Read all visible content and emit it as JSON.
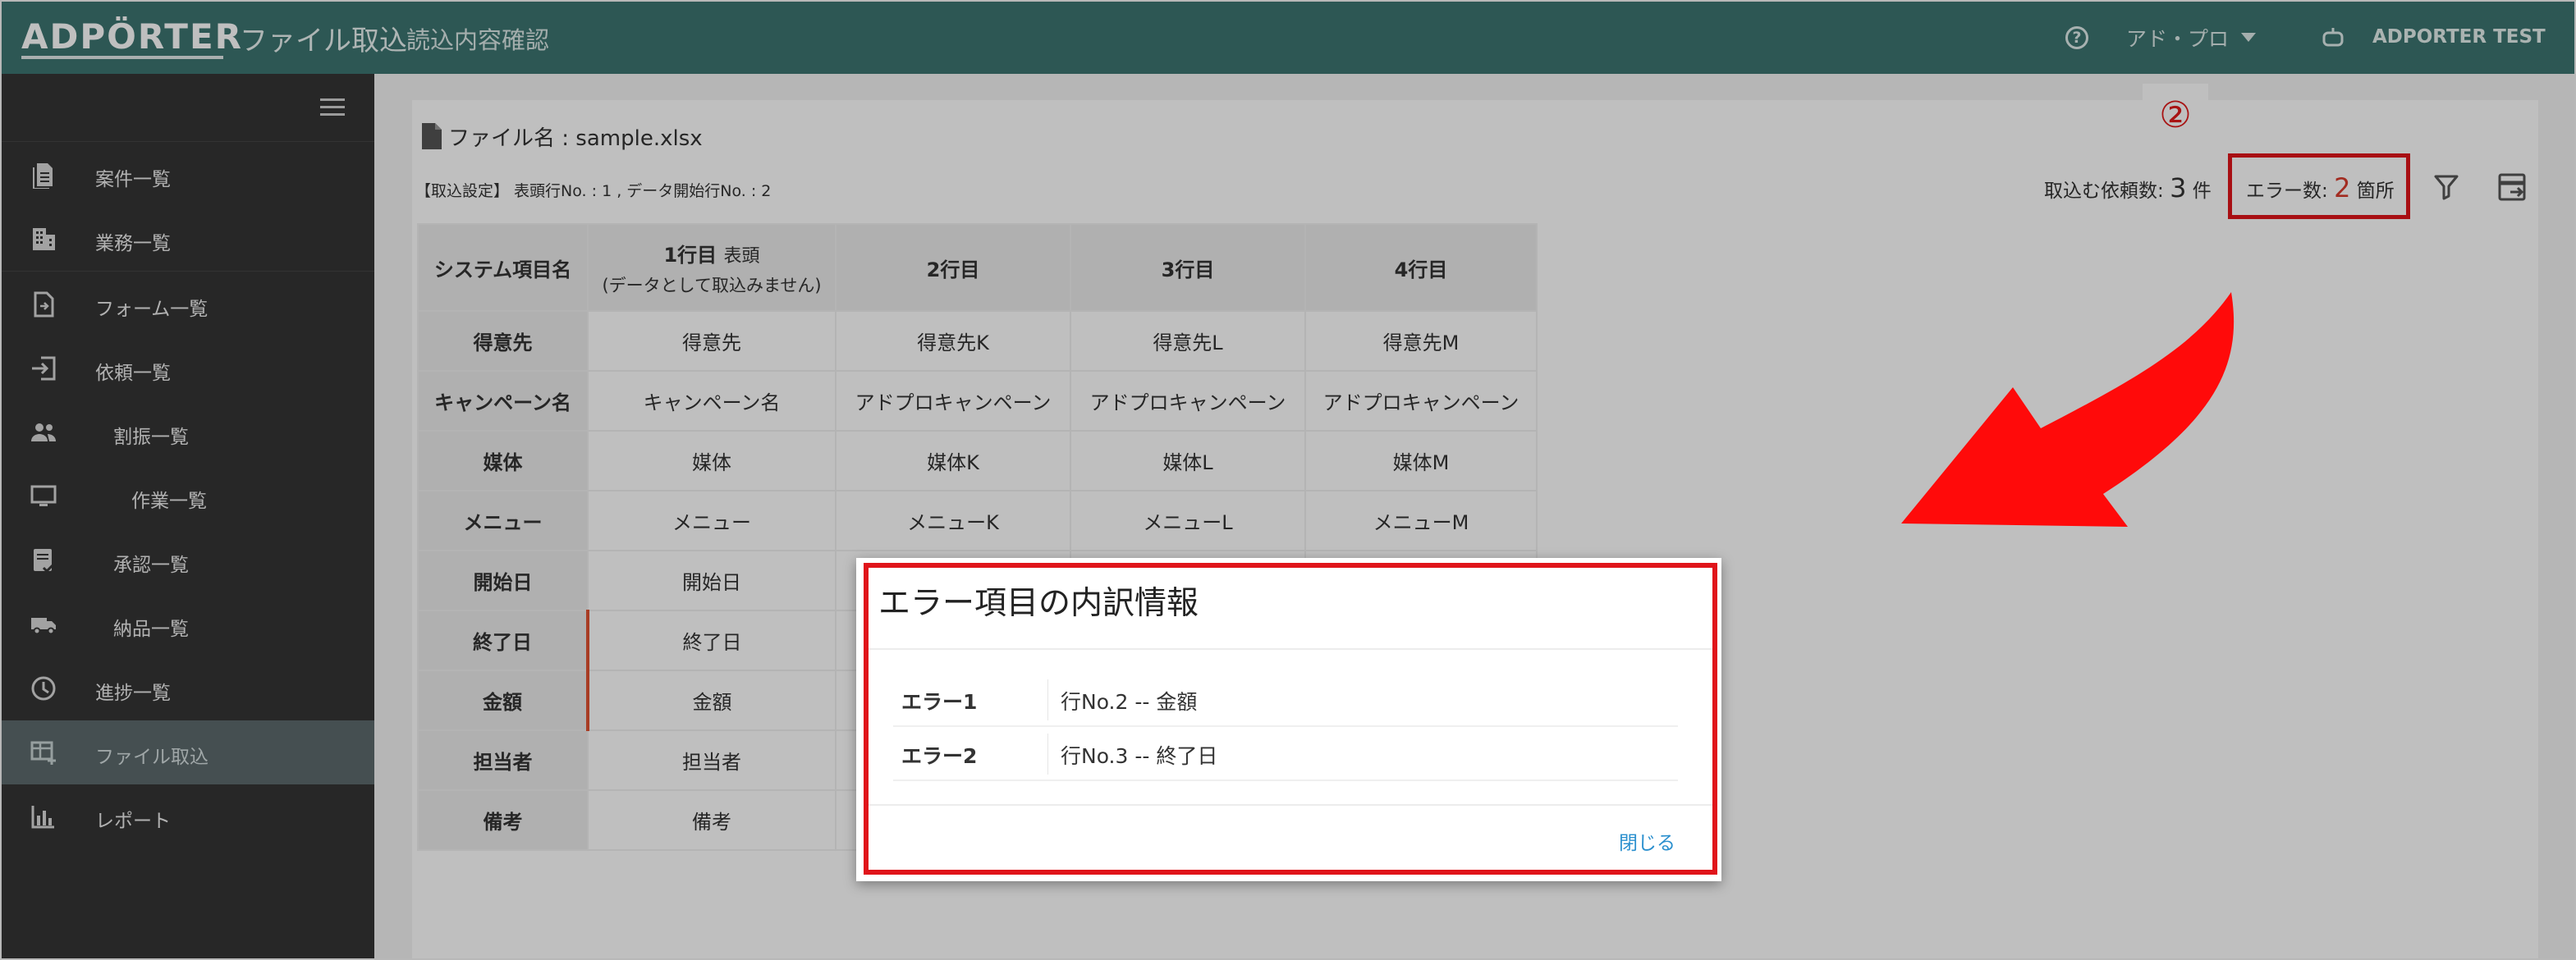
{
  "header": {
    "logo": "ADPÖRTER",
    "app_title": "ファイル取込",
    "app_subtitle": "読込内容確認",
    "help_icon": "question-circle-icon",
    "user_menu_label": "アド・プロ",
    "account_name": "ADPORTER TEST",
    "colors": {
      "bar": "#3d7570"
    }
  },
  "sidebar": {
    "items": [
      {
        "label": "案件一覧",
        "icon": "document-list-icon"
      },
      {
        "label": "業務一覧",
        "icon": "building-icon"
      },
      {
        "label": "フォーム一覧",
        "icon": "form-file-icon"
      },
      {
        "label": "依頼一覧",
        "icon": "sign-in-icon"
      },
      {
        "label": "割振一覧",
        "icon": "people-icon"
      },
      {
        "label": "作業一覧",
        "icon": "monitor-icon"
      },
      {
        "label": "承認一覧",
        "icon": "approval-icon"
      },
      {
        "label": "納品一覧",
        "icon": "truck-icon"
      },
      {
        "label": "進捗一覧",
        "icon": "clock-icon"
      },
      {
        "label": "ファイル取込",
        "icon": "table-add-icon",
        "active": true
      },
      {
        "label": "レポート",
        "icon": "bar-chart-icon"
      }
    ]
  },
  "main": {
    "file_label": "ファイル名 : sample.xlsx",
    "import_setting": "【取込設定】 表頭行No. : 1 , データ開始行No. : 2",
    "count_prefix": "取込む依頼数:",
    "count_value": "3",
    "count_suffix": "件",
    "error_prefix": "エラー数:",
    "error_value": "2",
    "error_suffix": "箇所",
    "step_badge": "②",
    "table": {
      "headers": [
        "システム項目名",
        "1行目",
        "2行目",
        "3行目",
        "4行目"
      ],
      "header1_tag": "表頭",
      "header1_note": "(データとして取込みません)",
      "rows": [
        [
          "得意先",
          "得意先",
          "得意先K",
          "得意先L",
          "得意先M"
        ],
        [
          "キャンペーン名",
          "キャンペーン名",
          "アドプロキャンペーン",
          "アドプロキャンペーン",
          "アドプロキャンペーン"
        ],
        [
          "媒体",
          "媒体",
          "媒体K",
          "媒体L",
          "媒体M"
        ],
        [
          "メニュー",
          "メニュー",
          "メニューK",
          "メニューL",
          "メニューM"
        ],
        [
          "開始日",
          "開始日",
          "",
          "",
          ""
        ],
        [
          "終了日",
          "終了日",
          "",
          "",
          ""
        ],
        [
          "金額",
          "金額",
          "",
          "",
          ""
        ],
        [
          "担当者",
          "担当者",
          "",
          "",
          ""
        ],
        [
          "備考",
          "備考",
          "",
          "",
          ""
        ]
      ]
    }
  },
  "modal": {
    "title": "エラー項目の内訳情報",
    "errors": [
      {
        "key": "エラー1",
        "value": "行No.2 -- 金額"
      },
      {
        "key": "エラー2",
        "value": "行No.3 -- 終了日"
      }
    ],
    "close_label": "閉じる"
  },
  "colors": {
    "highlight": "#e0141a",
    "link": "#2a8fce",
    "error_count": "#d83b2c"
  }
}
